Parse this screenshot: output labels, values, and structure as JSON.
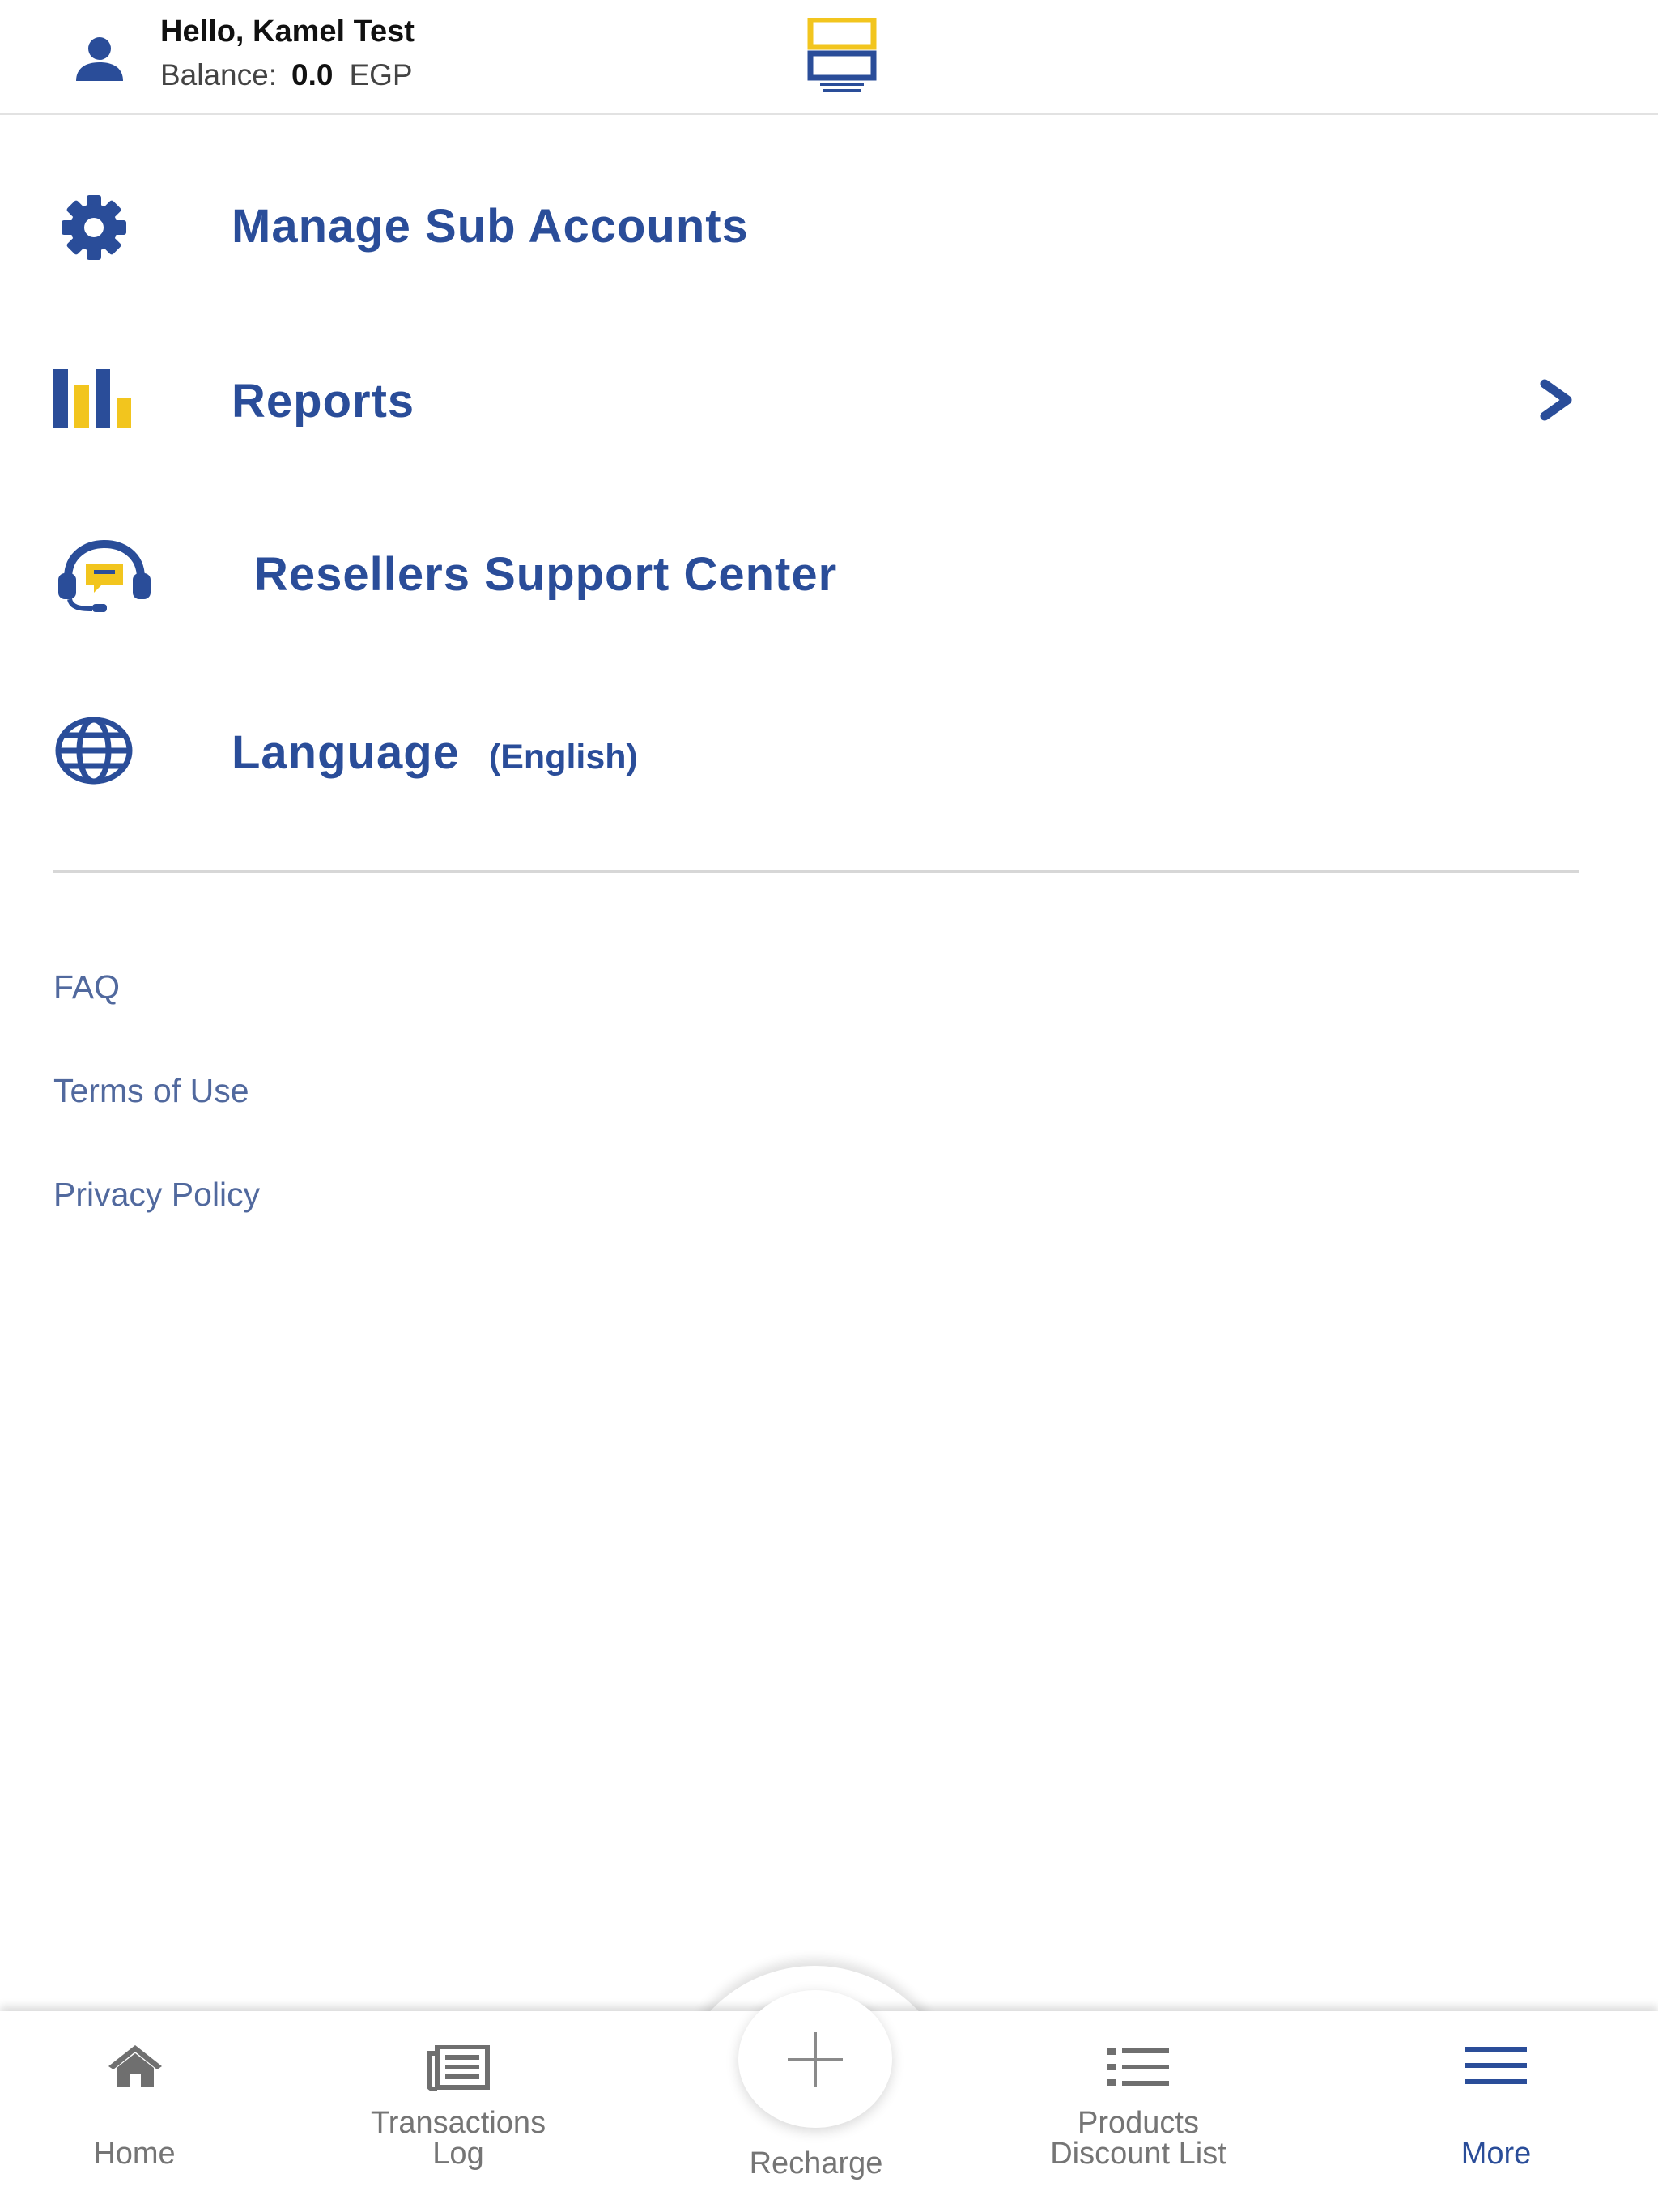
{
  "header": {
    "greeting": "Hello, Kamel Test",
    "balance_label": "Balance:",
    "balance_value": "0.0",
    "currency": "EGP",
    "logo_icon": "bitaqaty-business-logo"
  },
  "menu": {
    "items": [
      {
        "label": "Manage Sub Accounts",
        "icon": "gear-icon"
      },
      {
        "label": "Reports",
        "icon": "bar-chart-icon",
        "has_chevron": true
      },
      {
        "label": "Resellers Support Center",
        "icon": "headset-support-icon"
      },
      {
        "label": "Language",
        "sub": "(English)",
        "icon": "globe-icon"
      }
    ]
  },
  "links": {
    "faq": "FAQ",
    "terms": "Terms of Use",
    "privacy": "Privacy Policy"
  },
  "bottom_nav": {
    "home": "Home",
    "transactions_line1": "Transactions",
    "transactions_line2": "Log",
    "recharge": "Recharge",
    "products_line1": "Products",
    "products_line2": "Discount List",
    "more": "More",
    "active": "More"
  },
  "colors": {
    "primary": "#2a4d99",
    "accent_yellow": "#f2c51e",
    "link": "#51699e",
    "nav_inactive": "#757575"
  }
}
